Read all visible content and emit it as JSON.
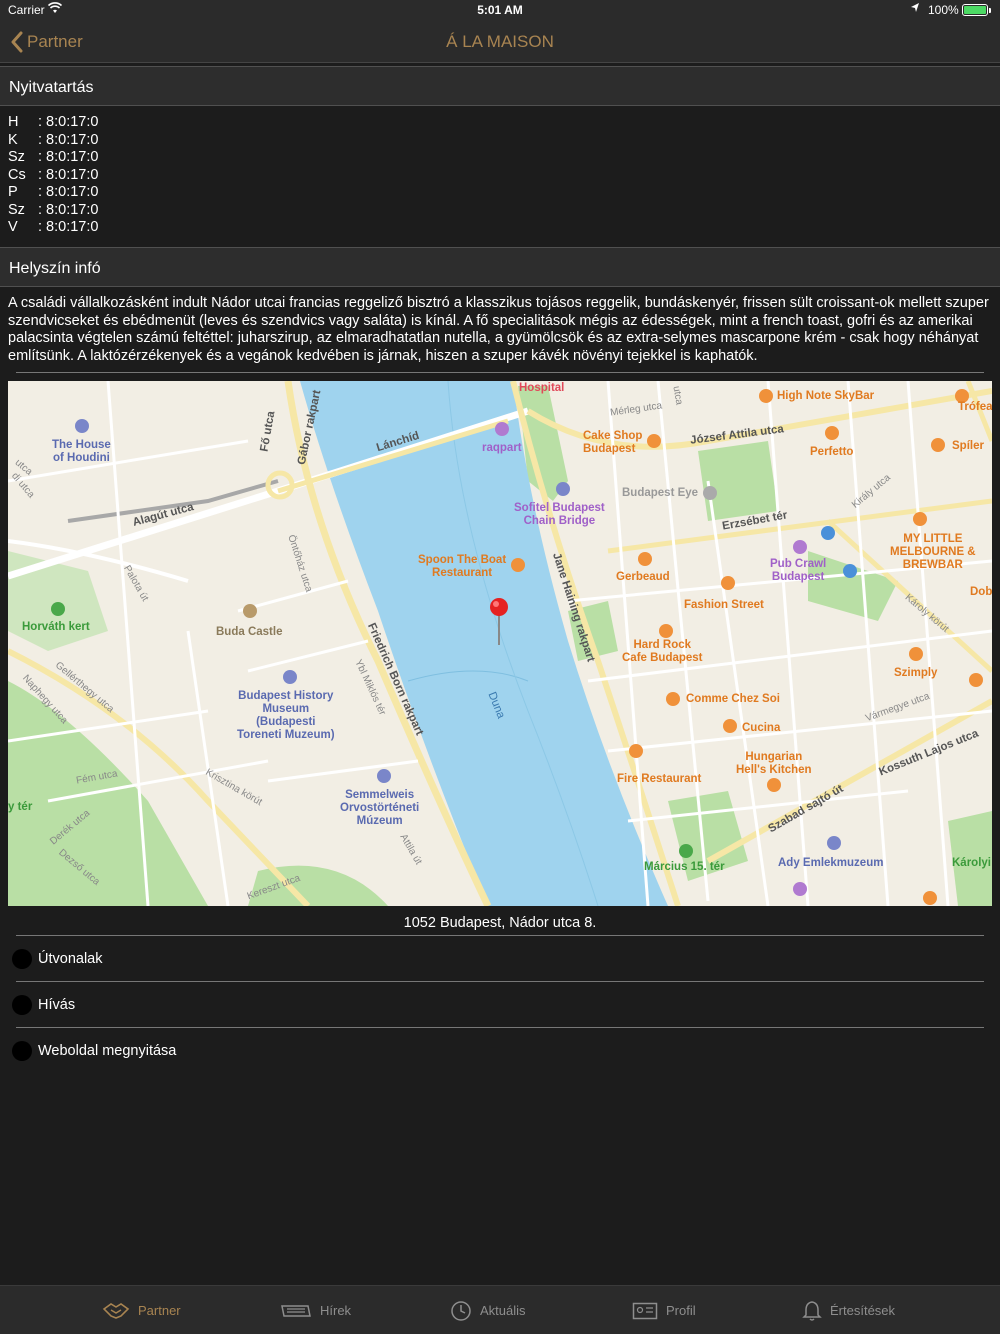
{
  "status": {
    "carrier": "Carrier",
    "time": "5:01 AM",
    "battery": "100%"
  },
  "nav": {
    "back_label": "Partner",
    "title": "Á LA MAISON"
  },
  "sections": {
    "hours_title": "Nyitvatartás",
    "location_title": "Helyszín infó"
  },
  "hours": [
    {
      "day": "H",
      "time": ": 8:0:17:0"
    },
    {
      "day": "K",
      "time": ": 8:0:17:0"
    },
    {
      "day": "Sz",
      "time": ": 8:0:17:0"
    },
    {
      "day": "Cs",
      "time": ": 8:0:17:0"
    },
    {
      "day": "P",
      "time": ": 8:0:17:0"
    },
    {
      "day": "Sz",
      "time": ": 8:0:17:0"
    },
    {
      "day": "V",
      "time": ": 8:0:17:0"
    }
  ],
  "location_info": "A családi vállalkozásként indult Nádor utcai francias reggeliző bisztró a klasszikus tojásos reggelik, bundáskenyér, frissen sült croissant-ok mellett szuper szendvicseket és ebédmenüt (leves és szendvics vagy saláta) is kínál. A fő specialitások mégis az édességek, mint a french toast, gofri és az amerikai palacsinta végtelen számú feltéttel: juharszirup, az elmaradhatatlan nutella, a gyümölcsök és az extra-selymes mascarpone krém - csak hogy néhányat említsünk. A laktózérzékenyek és a vegánok kedvében is járnak, hiszen a szuper kávék növényi tejekkel is kaphatók.",
  "map": {
    "labels": {
      "hospital": "Hospital",
      "high_note": "High Note SkyBar",
      "trofea": "Trófea",
      "house_houdini": "The House\nof Houdini",
      "lanchid": "Lánchíd",
      "raqpart": "raqpart",
      "cake_shop": "Cake Shop\nBudapest",
      "jozsef_attila": "József Attila utca",
      "perfetto": "Perfetto",
      "spiler": "Spíler",
      "merleg": "Mérleg utca",
      "budapest_eye": "Budapest Eye",
      "sofitel": "Sofitel Budapest\nChain Bridge",
      "erzsebet": "Erzsébet tér",
      "alagut": "Alagút utca",
      "spoon": "Spoon The Boat\nRestaurant",
      "gerbeaud": "Gerbeaud",
      "pub_crawl": "Pub Crawl\nBudapest",
      "my_little": "MY LITTLE\nMELBOURNE &\nBREWBAR",
      "horvath": "Horváth kert",
      "buda_castle": "Buda Castle",
      "fashion": "Fashion Street",
      "hard_rock": "Hard Rock\nCafe Budapest",
      "szimply": "Szimply",
      "history_museum": "Budapest History\nMuseum\n(Budapesti\nToreneti Muzeum)",
      "comme_chez": "Comme Chez Soi",
      "cucina": "Cucina",
      "hungarian": "Hungarian\nHell's Kitchen",
      "fire": "Fire Restaurant",
      "semmelweis": "Semmelweis\nOrvostörténeti\nMúzeum",
      "kossuth": "Kossuth Lajos utca",
      "szabad": "Szabad sajtó út",
      "marcius": "Március 15. tér",
      "ady": "Ady Emlekmuzeum",
      "duna": "Duna",
      "jane_haining": "Jane Haining rakpart",
      "friedrich": "Friedrich Born rakpart",
      "fo_utca": "Fő utca",
      "gabor": "Gábor rakpart",
      "ontohaz": "Öntőház utca",
      "palota": "Palota út",
      "krisztina": "Krisztina körút",
      "gellerthegy": "Gellérthegy utca",
      "naphegy": "Naphegy utca",
      "fem": "Fém utca",
      "derek": "Derék utca",
      "dezso": "Dezső utca",
      "kereszt": "Kereszt utca",
      "attila": "Attila út",
      "ybl": "Ybl Miklós tér",
      "karoly": "Károly körút",
      "karolyi": "Károlyi",
      "kiraly": "Király utca",
      "varmegye": "Vármegye utca",
      "dob": "Dob",
      "ter": "y tér",
      "utca_left": "utca",
      "di_utca": "di utca",
      "utca_top": "utca"
    }
  },
  "address": "1052 Budapest, Nádor utca 8.",
  "actions": [
    {
      "label": "Útvonalak"
    },
    {
      "label": "Hívás"
    },
    {
      "label": "Weboldal megnyitása"
    }
  ],
  "tabs": [
    {
      "label": "Partner",
      "icon": "handshake-icon"
    },
    {
      "label": "Hírek",
      "icon": "newspaper-icon"
    },
    {
      "label": "Aktuális",
      "icon": "clock-icon"
    },
    {
      "label": "Profil",
      "icon": "id-card-icon"
    },
    {
      "label": "Értesítések",
      "icon": "bell-icon"
    }
  ],
  "colors": {
    "accent": "#a88451",
    "background": "#1c1c1c",
    "bar": "#2b2b2b",
    "water": "#9fd3ee",
    "park": "#b9dfa5",
    "poi": "#f0913a"
  }
}
